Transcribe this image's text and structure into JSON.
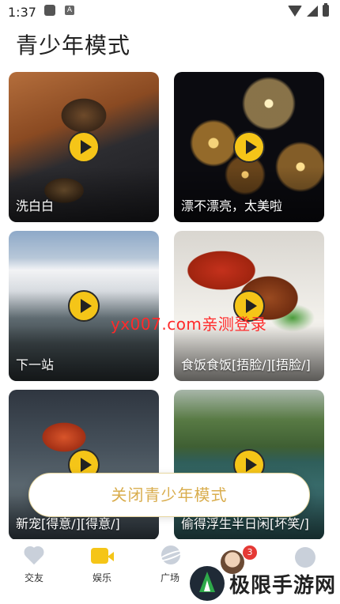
{
  "status_bar": {
    "time": "1:37",
    "notif_icon": "A"
  },
  "page": {
    "title": "青少年模式"
  },
  "videos": [
    {
      "label": "洗白白"
    },
    {
      "label": "漂不漂亮，太美啦"
    },
    {
      "label": "下一站"
    },
    {
      "label": "食饭食饭[捂脸/][捂脸/]"
    },
    {
      "label": "新宠[得意/][得意/]"
    },
    {
      "label": "偷得浮生半日闲[坏笑/]"
    }
  ],
  "overlay_watermark": "yx007.com亲测登录",
  "close_button": {
    "label": "关闭青少年模式"
  },
  "tabs": [
    {
      "label": "交友",
      "icon": "heart-icon"
    },
    {
      "label": "娱乐",
      "icon": "video-camera-icon"
    },
    {
      "label": "广场",
      "icon": "planet-icon"
    },
    {
      "label": "",
      "icon": "avatar-icon",
      "badge": "3"
    },
    {
      "label": "",
      "icon": "profile-icon"
    }
  ],
  "brand_logo_text": "极限手游网",
  "colors": {
    "accent": "#f5c518",
    "button_text": "#d9ad4d",
    "badge": "#e53935"
  }
}
